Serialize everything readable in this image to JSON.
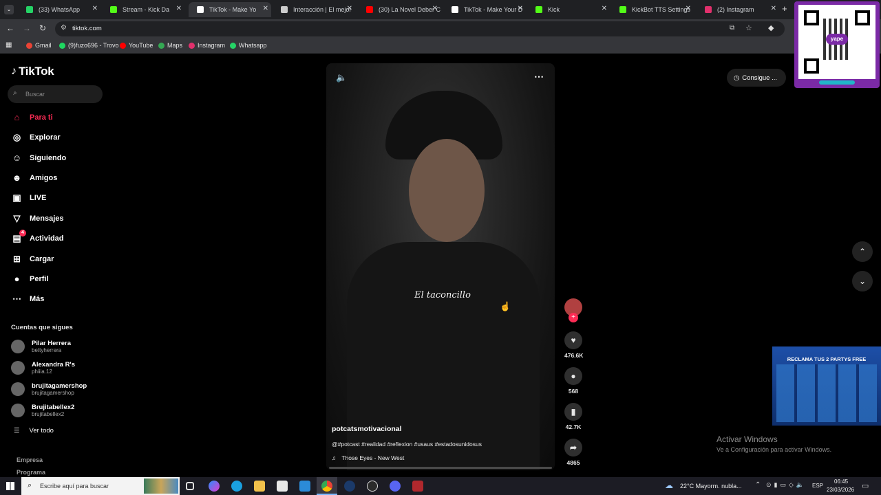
{
  "browser": {
    "tabs": [
      {
        "label": "(33) WhatsApp",
        "color": "#25d366"
      },
      {
        "label": "Stream - Kick Da",
        "color": "#53fc18"
      },
      {
        "label": "TikTok - Make Yo",
        "color": "#ffffff"
      },
      {
        "label": "Interacción | El mejor",
        "color": "#cccccc"
      },
      {
        "label": "(30) La Novel Deber C",
        "color": "#ff0000"
      },
      {
        "label": "TikTok - Make Your D",
        "color": "#ffffff"
      },
      {
        "label": "Kick",
        "color": "#53fc18"
      },
      {
        "label": "KickBot TTS Settings",
        "color": "#53fc18"
      },
      {
        "label": "(2) Instagram",
        "color": "#e1306c"
      }
    ],
    "url": "tiktok.com",
    "bookmarks": [
      {
        "label": "Gmail",
        "color": "#ea4335"
      },
      {
        "label": "(9)fuzo696 - Trovo",
        "color": "#1ed760"
      },
      {
        "label": "YouTube",
        "color": "#ff0000"
      },
      {
        "label": "Maps",
        "color": "#34a853"
      },
      {
        "label": "Instagram",
        "color": "#e1306c"
      },
      {
        "label": "Whatsapp",
        "color": "#25d366"
      }
    ]
  },
  "tiktok": {
    "logo": "TikTok",
    "search_placeholder": "Buscar",
    "nav": [
      {
        "label": "Para ti",
        "icon": "home-icon",
        "glyph": "⌂",
        "accent": true
      },
      {
        "label": "Explorar",
        "icon": "compass-icon",
        "glyph": "◎"
      },
      {
        "label": "Siguiendo",
        "icon": "following-icon",
        "glyph": "☺"
      },
      {
        "label": "Amigos",
        "icon": "friends-icon",
        "glyph": "☻"
      },
      {
        "label": "LIVE",
        "icon": "live-icon",
        "glyph": "▣"
      },
      {
        "label": "Mensajes",
        "icon": "messages-icon",
        "glyph": "▽"
      },
      {
        "label": "Actividad",
        "icon": "activity-icon",
        "glyph": "▤",
        "badge": "4"
      },
      {
        "label": "Cargar",
        "icon": "upload-icon",
        "glyph": "⊞"
      },
      {
        "label": "Perfil",
        "icon": "profile-icon",
        "glyph": "●"
      },
      {
        "label": "Más",
        "icon": "more-icon",
        "glyph": "⋯"
      }
    ],
    "following_title": "Cuentas que sigues",
    "following": [
      {
        "name": "Pilar Herrera",
        "handle": "bettyherrera"
      },
      {
        "name": "Alexandra R's",
        "handle": "phiiia.12"
      },
      {
        "name": "brujitagamershop",
        "handle": "brujitagamershop"
      },
      {
        "name": "Brujitabellex2",
        "handle": "brujitabellex2"
      }
    ],
    "see_all": "Ver todo",
    "footer": [
      "Empresa",
      "Programa"
    ],
    "video": {
      "caption_overlay": "El taconcillo",
      "username": "potcatsmotivacional",
      "description": "@#potcast #realidad #reflexion #usaus #estadosunidosus",
      "music": "Those Eyes - New West"
    },
    "actions": {
      "likes": "476.6K",
      "comments": "568",
      "saves": "42.7K",
      "shares": "4865"
    },
    "get_coins": "Consigue ..."
  },
  "overlays": {
    "activate_windows_title": "Activar Windows",
    "activate_windows_sub": "Ve a Configuración para activar Windows.",
    "ad_title": "RECLAMA TUS 2 PARTYS FREE",
    "qr_caption": "yape"
  },
  "taskbar": {
    "search_placeholder": "Escribe aquí para buscar",
    "weather": "22°C  Mayorm. nubla...",
    "lang": "ESP",
    "time": "06:45",
    "date": "23/03/2026"
  }
}
